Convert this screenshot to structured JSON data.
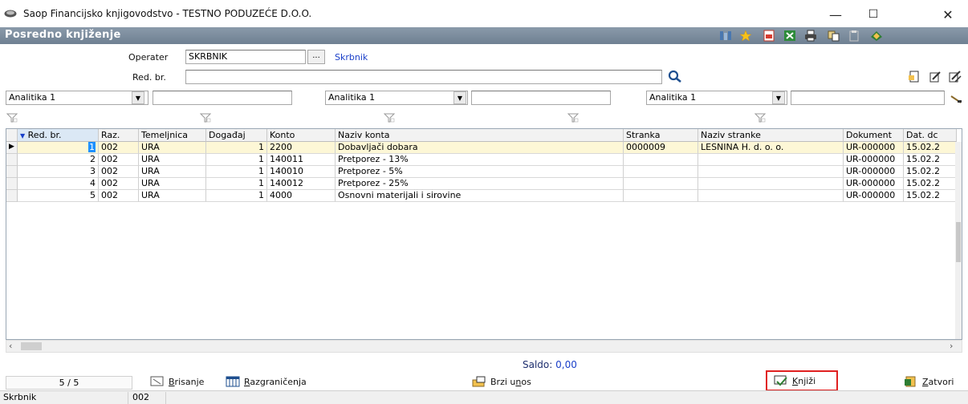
{
  "window": {
    "title": "Saop Financijsko knjigovodstvo - TESTNO PODUZEĆE D.O.O.",
    "minimize": "—",
    "maximize": "☐",
    "close": "✕"
  },
  "header": {
    "title": "Posredno knjiženje"
  },
  "form": {
    "operater_label": "Operater",
    "operater_value": "SKRBNIK",
    "operater_browse": "...",
    "operater_name": "Skrbnik",
    "redbr_label": "Red. br.",
    "redbr_value": ""
  },
  "filters": [
    {
      "select": "Analitika 1",
      "value": ""
    },
    {
      "select": "Analitika 1",
      "value": ""
    },
    {
      "select": "Analitika 1",
      "value": ""
    }
  ],
  "grid": {
    "columns": [
      "Red. br.",
      "Raz.",
      "Temeljnica",
      "Događaj",
      "Konto",
      "Naziv konta",
      "Stranka",
      "Naziv stranke",
      "Dokument",
      "Dat. dc"
    ],
    "rows": [
      {
        "redbr": "1",
        "raz": "002",
        "temeljnica": "URA",
        "dogadaj": "1",
        "konto": "2200",
        "naziv_konta": "Dobavljači dobara",
        "stranka": "0000009",
        "naziv_stranke": "LESNINA H. d. o. o.",
        "dokument": "UR-000000",
        "datum": "15.02.2"
      },
      {
        "redbr": "2",
        "raz": "002",
        "temeljnica": "URA",
        "dogadaj": "1",
        "konto": "140011",
        "naziv_konta": "Pretporez - 13%",
        "stranka": "",
        "naziv_stranke": "",
        "dokument": "UR-000000",
        "datum": "15.02.2"
      },
      {
        "redbr": "3",
        "raz": "002",
        "temeljnica": "URA",
        "dogadaj": "1",
        "konto": "140010",
        "naziv_konta": "Pretporez - 5%",
        "stranka": "",
        "naziv_stranke": "",
        "dokument": "UR-000000",
        "datum": "15.02.2"
      },
      {
        "redbr": "4",
        "raz": "002",
        "temeljnica": "URA",
        "dogadaj": "1",
        "konto": "140012",
        "naziv_konta": "Pretporez - 25%",
        "stranka": "",
        "naziv_stranke": "",
        "dokument": "UR-000000",
        "datum": "15.02.2"
      },
      {
        "redbr": "5",
        "raz": "002",
        "temeljnica": "URA",
        "dogadaj": "1",
        "konto": "4000",
        "naziv_konta": "Osnovni materijali i sirovine",
        "stranka": "",
        "naziv_stranke": "",
        "dokument": "UR-000000",
        "datum": "15.02.2"
      }
    ]
  },
  "saldo": {
    "label": "Saldo:",
    "value": "0,00"
  },
  "bottom": {
    "record_counter": "5 / 5",
    "brisanje": {
      "pre": "",
      "u": "B",
      "post": "risanje"
    },
    "razgranicenja": {
      "pre": "",
      "u": "R",
      "post": "azgraničenja"
    },
    "brzi_unos": {
      "pre": "Brzi u",
      "u": "n",
      "post": "os"
    },
    "knjizi": {
      "pre": "",
      "u": "K",
      "post": "njiži"
    },
    "zatvori": {
      "pre": "",
      "u": "Z",
      "post": "atvori"
    }
  },
  "status": {
    "user": "Skrbnik",
    "code": "002"
  },
  "colors": {
    "header_bg": "#7a8a9c",
    "selected_cell": "#1e90ff",
    "link": "#1a3fc9",
    "highlight_box": "#e02020"
  }
}
